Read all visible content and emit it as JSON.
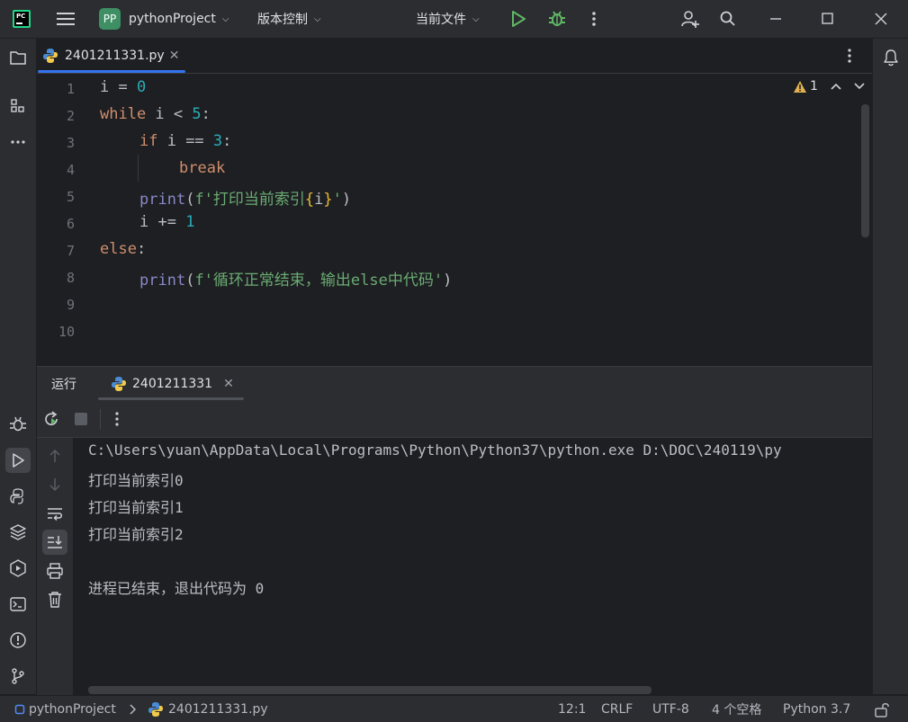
{
  "titlebar": {
    "project_badge": "PP",
    "project_name": "pythonProject",
    "vcs_label": "版本控制",
    "run_config": "当前文件"
  },
  "editor": {
    "tab_label": "2401211331.py",
    "warnings_count": "1",
    "line_numbers": [
      "1",
      "2",
      "3",
      "4",
      "5",
      "6",
      "7",
      "8",
      "9",
      "10"
    ],
    "lines": {
      "l1": {
        "a": "i = ",
        "b": "0"
      },
      "l2": {
        "a": "while",
        "b": " i < ",
        "c": "5",
        "d": ":"
      },
      "l3": {
        "a": "if",
        "b": " i == ",
        "c": "3",
        "d": ":"
      },
      "l4": {
        "a": "break"
      },
      "l5": {
        "a": "print",
        "b": "(",
        "c": "f'打印当前索引",
        "d": "{",
        "e": "i",
        "f": "}",
        "g": "'",
        "h": ")"
      },
      "l6": {
        "a": "i += ",
        "b": "1"
      },
      "l7": {
        "a": "else",
        "b": ":"
      },
      "l8": {
        "a": "print",
        "b": "(",
        "c": "f'循环正常结束，输出else中代码'",
        "d": ")"
      }
    }
  },
  "run_panel": {
    "tab_run": "运行",
    "tab_config": "2401211331",
    "console": [
      "C:\\Users\\yuan\\AppData\\Local\\Programs\\Python\\Python37\\python.exe D:\\DOC\\240119\\py",
      "打印当前索引0",
      "打印当前索引1",
      "打印当前索引2",
      "",
      "进程已结束，退出代码为 0"
    ]
  },
  "statusbar": {
    "breadcrumb_project": "pythonProject",
    "breadcrumb_file": "2401211331.py",
    "position": "12:1",
    "line_ending": "CRLF",
    "encoding": "UTF-8",
    "indent": "4 个空格",
    "interpreter": "Python 3.7"
  },
  "colors": {
    "accent": "#3574f0",
    "keyword": "#cf8e6d",
    "number": "#2aacb8",
    "string": "#6aab73",
    "builtin": "#8888c6",
    "run_green": "#5fb865",
    "warning": "#e0b050"
  }
}
